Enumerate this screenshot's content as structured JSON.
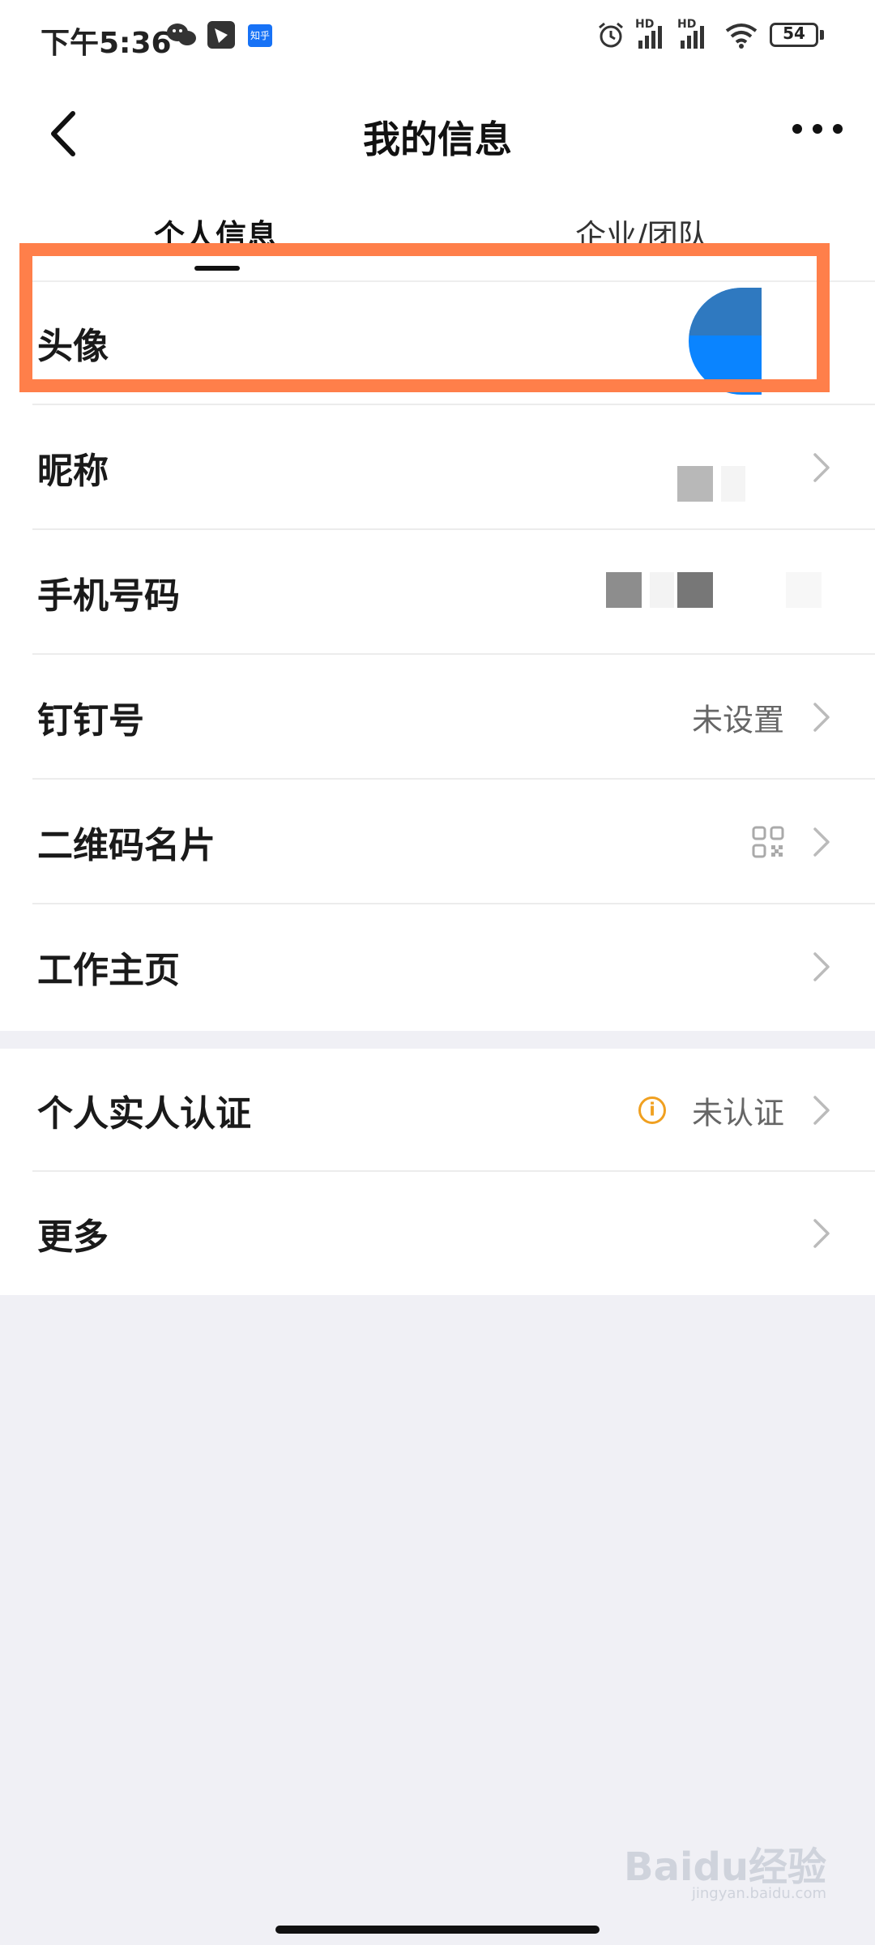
{
  "status": {
    "time": "下午5:36",
    "battery": "54",
    "signal1": "HD",
    "signal2": "HD",
    "zhihu": "知乎"
  },
  "nav": {
    "title": "我的信息"
  },
  "tabs": [
    {
      "label": "个人信息",
      "active": true
    },
    {
      "label": "企业/团队",
      "active": false
    }
  ],
  "rows": [
    {
      "label": "头像",
      "value": ""
    },
    {
      "label": "昵称",
      "value": ""
    },
    {
      "label": "手机号码",
      "value": ""
    },
    {
      "label": "钉钉号",
      "value": "未设置"
    },
    {
      "label": "二维码名片",
      "value": ""
    },
    {
      "label": "工作主页",
      "value": ""
    },
    {
      "label": "个人实人认证",
      "value": "未认证"
    },
    {
      "label": "更多",
      "value": ""
    }
  ],
  "icons": {
    "back": "back-chevron-icon",
    "more": "more-dots-icon",
    "chevron": "chevron-right-icon",
    "qr": "qr-code-icon",
    "info": "info-icon"
  },
  "colors": {
    "highlight": "#ff7f4a",
    "accent": "#0a84ff",
    "warning": "#f0a020"
  },
  "watermark": {
    "brand": "Baidu经验",
    "url": "jingyan.baidu.com"
  }
}
